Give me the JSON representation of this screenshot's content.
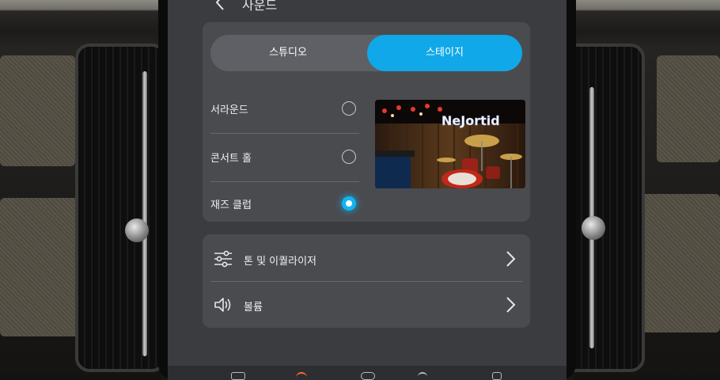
{
  "header": {
    "title": "사운드",
    "back_icon": "chevron-left-icon"
  },
  "mode_selector": {
    "options": [
      {
        "label": "스튜디오",
        "selected": false
      },
      {
        "label": "스테이지",
        "selected": true
      }
    ],
    "accent_color": "#10a8e8"
  },
  "venues": [
    {
      "label": "서라운드",
      "selected": false
    },
    {
      "label": "콘서트 홀",
      "selected": false
    },
    {
      "label": "재즈 클럽",
      "selected": true
    }
  ],
  "preview_image": {
    "sign_text": "NeJortid"
  },
  "menu": [
    {
      "label": "톤 및 이퀄라이저",
      "icon": "equalizer-sliders-icon"
    },
    {
      "label": "볼륨",
      "icon": "speaker-volume-icon"
    }
  ]
}
